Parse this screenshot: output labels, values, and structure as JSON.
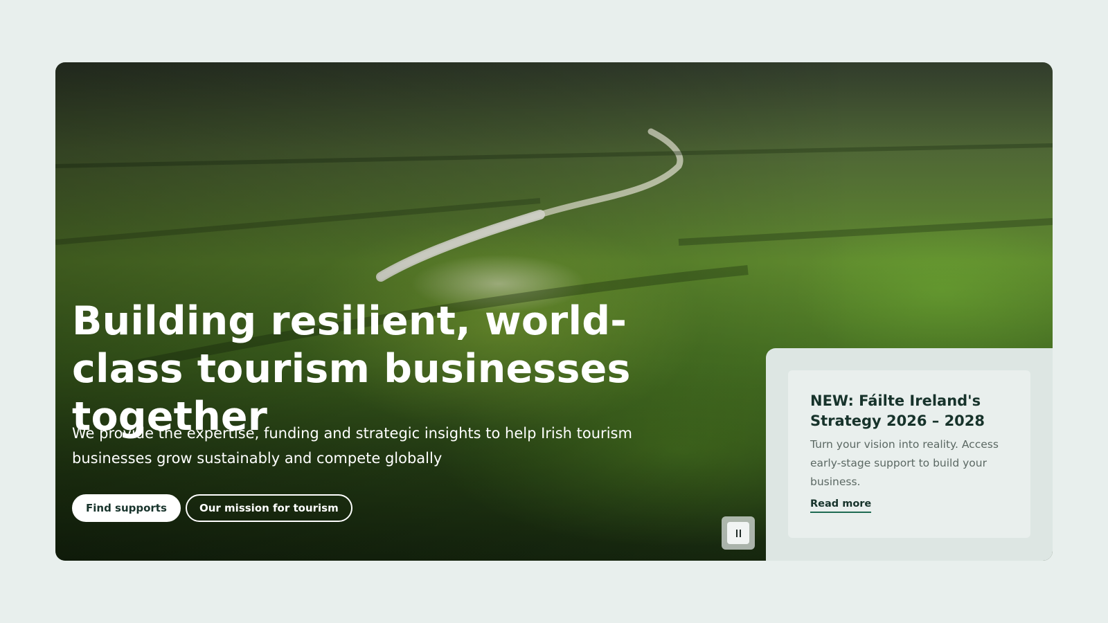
{
  "hero": {
    "headline": "Building resilient, world-class tourism businesses together",
    "subtext": "We provide the expertise, funding and strategic insights to help Irish tourism businesses grow sustainably and compete globally",
    "primary_button": "Find supports",
    "secondary_button": "Our mission for tourism",
    "pause_icon": "pause-icon"
  },
  "promo_card": {
    "title": "NEW: Fáilte Ireland's Strategy 2026 – 2028",
    "text": "Turn your vision into reality. Access early-stage support to build your business.",
    "link": "Read more"
  },
  "colors": {
    "page_background": "#e8efed",
    "brand_dark": "#17332b",
    "link_underline": "#1e6b52",
    "card_panel": "#dde6e3"
  }
}
